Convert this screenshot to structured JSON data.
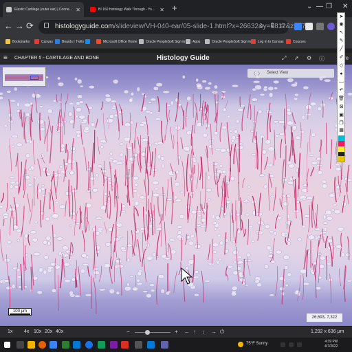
{
  "browser": {
    "tabs": [
      {
        "title": "Elastic Cartilage (outer ear) | Connective Tissue",
        "favicon_color": "#c8c8c8",
        "active": true
      },
      {
        "title": "BI 160 histology Walk Through - YouTube",
        "favicon_color": "#ff0000",
        "active": false
      }
    ],
    "new_tab": "+",
    "window_controls": [
      "⌄",
      "—",
      "❐",
      "✕"
    ],
    "nav": {
      "back": "←",
      "forward": "→",
      "reload": "⟳",
      "home": "⌂"
    },
    "url_domain": "histologyguide.com",
    "url_path": "/slideview/VH-040-ear/05-slide-1.html?x=26632&y=6812&z=27.9",
    "omnibox_icons": [
      "search-icon",
      "share-icon",
      "star-icon"
    ],
    "extension_colors": [
      "#3a86ff",
      "#e8e8e8",
      "#777777",
      "#dddddd",
      "#6b5bd2"
    ]
  },
  "bookmarks": [
    {
      "label": "Bookmarks",
      "color": "#f5c542"
    },
    {
      "label": "Canvas",
      "color": "#e23d2e"
    },
    {
      "label": "Boards | Trello",
      "color": "#2d7ce0"
    },
    {
      "label": "",
      "color": "#1e88e5"
    },
    {
      "label": "Microsoft Office Home",
      "color": "#e74c2e"
    },
    {
      "label": "Oracle PeopleSoft Sign in",
      "color": "#bbbbbb"
    },
    {
      "label": "Apps",
      "color": "#bbbbbb"
    },
    {
      "label": "Oracle PeopleSoft Sign in",
      "color": "#bbbbbb"
    },
    {
      "label": "Log in to Canvas",
      "color": "#e23d2e"
    },
    {
      "label": "Courses",
      "color": "#e23d2e"
    }
  ],
  "app": {
    "chapter": "CHAPTER 5 - CARTILAGE AND BONE",
    "title": "Histology Guide",
    "hdr_more": "re"
  },
  "viewer": {
    "select_view": "Select View",
    "scale_label": "100 μm",
    "coords": "26,693, 7,322",
    "zoom_levels": [
      "1x",
      "4x",
      "10x",
      "20x",
      "40x"
    ],
    "dims": "1,292 x 636 μm",
    "tissue_colors": {
      "perichondrium": "#8d86c8",
      "matrix": "#d9d3ea",
      "fiber": "#c2185b",
      "lacuna": "#f2eef8"
    }
  },
  "toolbar_swatches": [
    "#00bcd4",
    "#e91e63",
    "#ffeb3b",
    "#212121",
    "#e6c400"
  ],
  "taskbar": {
    "weather": "75°F  Sunny",
    "time": "4:39 PM",
    "date": "4/7/2022",
    "app_colors": [
      "#f0b400",
      "#e66000",
      "#3b83f5",
      "#2f7d32",
      "#0078d4",
      "#1a73e8",
      "#d93025",
      "#7b1fa2",
      "#0f9d58"
    ]
  }
}
